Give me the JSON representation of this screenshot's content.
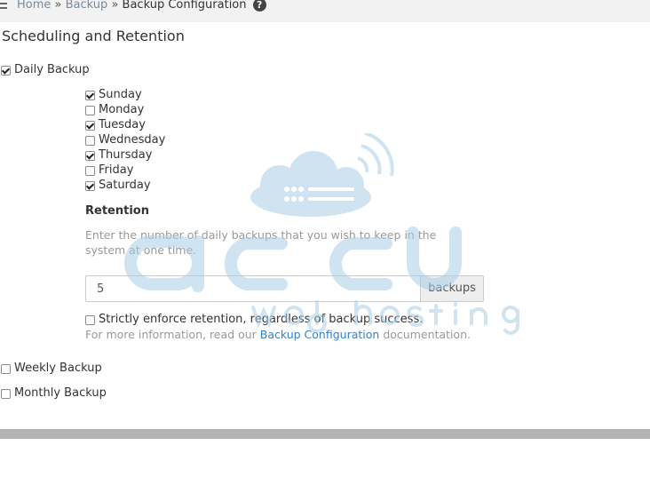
{
  "breadcrumb": {
    "home": "Home",
    "sep1": "»",
    "backup": "Backup",
    "sep2": "»",
    "current": "Backup Configuration",
    "help_glyph": "?"
  },
  "section": {
    "title": "Scheduling and Retention"
  },
  "daily": {
    "label": "Daily Backup",
    "checked": true,
    "days": [
      {
        "label": "Sunday",
        "checked": true
      },
      {
        "label": "Monday",
        "checked": false
      },
      {
        "label": "Tuesday",
        "checked": true
      },
      {
        "label": "Wednesday",
        "checked": false
      },
      {
        "label": "Thursday",
        "checked": true
      },
      {
        "label": "Friday",
        "checked": false
      },
      {
        "label": "Saturday",
        "checked": true
      }
    ],
    "retention": {
      "label": "Retention",
      "help": "Enter the number of daily backups that you wish to keep in the system at one time.",
      "value": "5",
      "unit": "backups"
    },
    "strict": {
      "label": "Strictly enforce retention, regardless of backup success.",
      "checked": false
    },
    "info": {
      "prefix": "For more information, read our",
      "link": "Backup Configuration",
      "suffix": "documentation."
    }
  },
  "weekly": {
    "label": "Weekly Backup",
    "checked": false
  },
  "monthly": {
    "label": "Monthly Backup",
    "checked": false
  },
  "watermark": {
    "line1": "accu",
    "line2": "web hosting"
  },
  "colors": {
    "link": "#3a7fc0",
    "muted_text": "#999999",
    "watermark": "#a9cde6"
  }
}
